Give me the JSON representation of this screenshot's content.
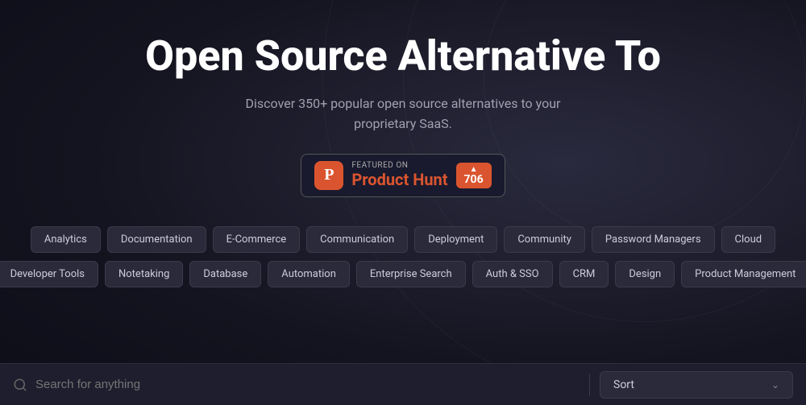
{
  "hero": {
    "title": "Open Source Alternative To",
    "subtitle": "Discover 350+ popular open source alternatives to your proprietary SaaS."
  },
  "product_hunt": {
    "featured_label": "FEATURED ON",
    "name": "Product Hunt",
    "logo_letter": "P",
    "votes": "706",
    "arrow": "▲"
  },
  "categories_row1": [
    {
      "label": "Analytics"
    },
    {
      "label": "Documentation"
    },
    {
      "label": "E-Commerce"
    },
    {
      "label": "Communication"
    },
    {
      "label": "Deployment"
    },
    {
      "label": "Community"
    },
    {
      "label": "Password Managers"
    },
    {
      "label": "Cloud"
    }
  ],
  "categories_row2": [
    {
      "label": "Developer Tools"
    },
    {
      "label": "Notetaking"
    },
    {
      "label": "Database"
    },
    {
      "label": "Automation"
    },
    {
      "label": "Enterprise Search"
    },
    {
      "label": "Auth & SSO"
    },
    {
      "label": "CRM"
    },
    {
      "label": "Design"
    },
    {
      "label": "Product Management"
    }
  ],
  "search": {
    "placeholder": "Search for anything"
  },
  "sort": {
    "label": "Sort",
    "chevron": "⌄"
  }
}
